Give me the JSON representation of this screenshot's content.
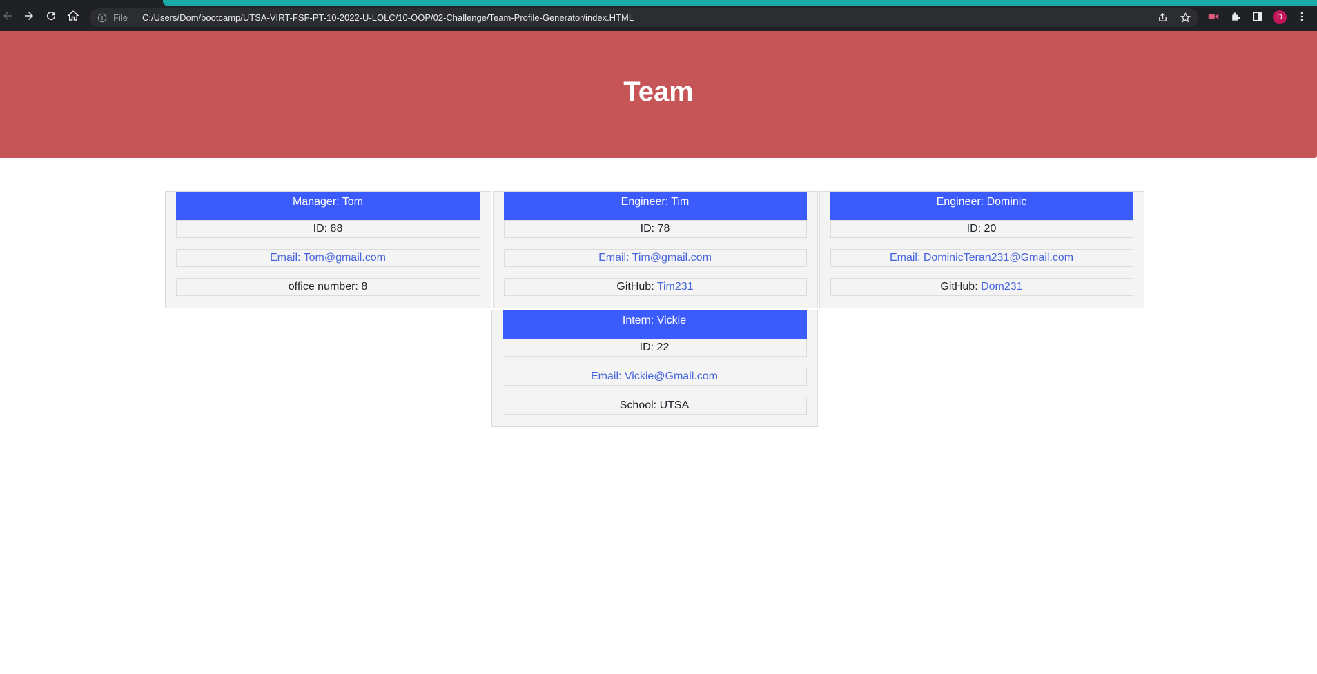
{
  "browser": {
    "file_label": "File",
    "url": "C:/Users/Dom/bootcamp/UTSA-VIRT-FSF-PT-10-2022-U-LOLC/10-OOP/02-Challenge/Team-Profile-Generator/index.HTML",
    "profile_initial": "D",
    "accent_color": "#1aa8a8"
  },
  "page": {
    "title": "Team",
    "hero_color": "#c55556",
    "card_header_color": "#3b5bfd"
  },
  "members": [
    {
      "header": "Manager: Tom",
      "id": "ID: 88",
      "email": "Email: Tom@gmail.com",
      "extra_prefix": "office number: 8",
      "extra_link": ""
    },
    {
      "header": "Engineer: Tim",
      "id": "ID: 78",
      "email": "Email: Tim@gmail.com",
      "extra_prefix": "GitHub: ",
      "extra_link": "Tim231"
    },
    {
      "header": "Engineer: Dominic",
      "id": "ID: 20",
      "email": "Email: DominicTeran231@Gmail.com",
      "extra_prefix": "GitHub: ",
      "extra_link": "Dom231"
    },
    {
      "header": "Intern: Vickie",
      "id": "ID: 22",
      "email": "Email: Vickie@Gmail.com",
      "extra_prefix": "School: UTSA",
      "extra_link": ""
    }
  ]
}
